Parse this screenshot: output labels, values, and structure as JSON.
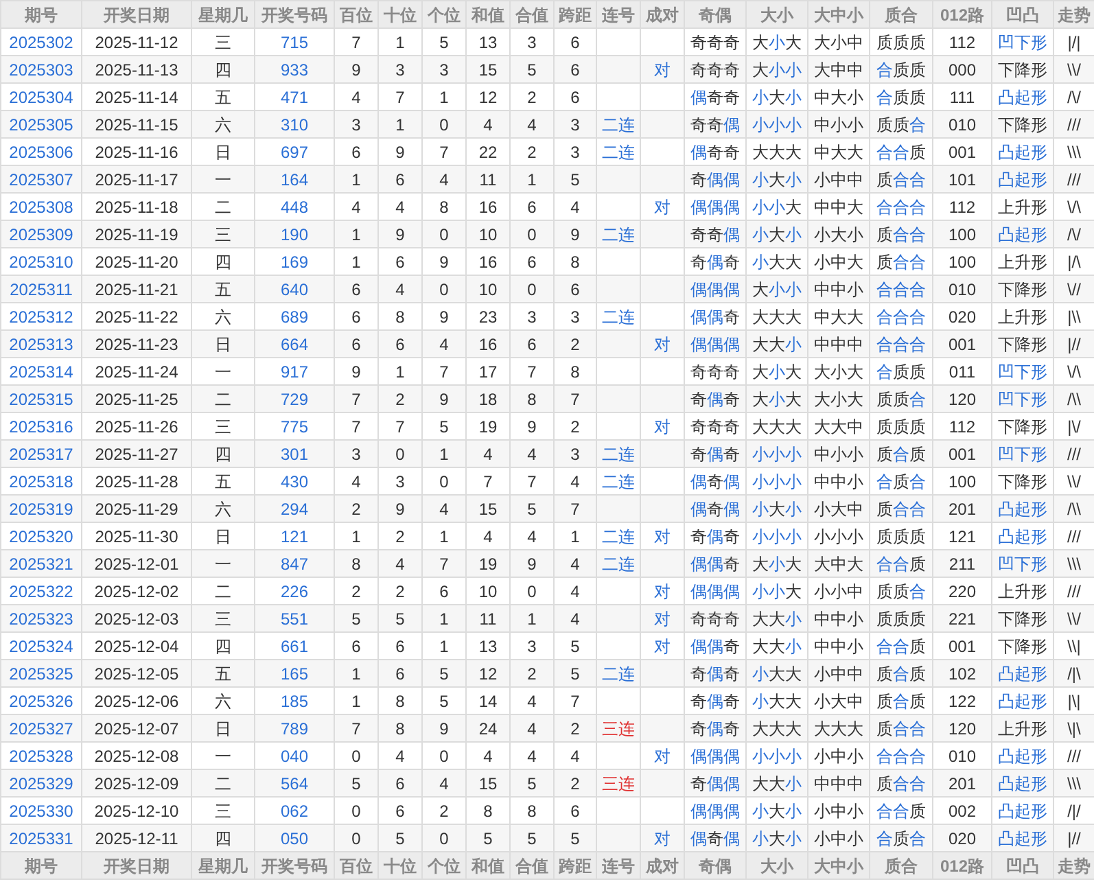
{
  "header": [
    "期号",
    "开奖日期",
    "星期几",
    "开奖号码",
    "百位",
    "十位",
    "个位",
    "和值",
    "合值",
    "跨距",
    "连号",
    "成对",
    "奇偶",
    "大小",
    "大中小",
    "质合",
    "012路",
    "凹凸",
    "走势"
  ],
  "rows": [
    {
      "issue": "2025302",
      "date": "2025-11-12",
      "weekday": "三",
      "number": "715",
      "hundreds": "7",
      "tens": "1",
      "ones": "5",
      "sum": "13",
      "sum_tail": "3",
      "span": "6",
      "parity": {
        "text": "奇奇奇",
        "hl": [
          false,
          false,
          false
        ]
      },
      "size": {
        "text": "大小大",
        "hl": [
          false,
          true,
          false
        ]
      },
      "bms": "大小中",
      "prime": {
        "text": "质质质",
        "hl": [
          false,
          false,
          false
        ]
      },
      "route012": "112",
      "shape": {
        "text": "凹下形",
        "hl": true
      },
      "trend": "|/|"
    },
    {
      "issue": "2025303",
      "date": "2025-11-13",
      "weekday": "四",
      "number": "933",
      "hundreds": "9",
      "tens": "3",
      "ones": "3",
      "sum": "15",
      "sum_tail": "5",
      "span": "6",
      "pair": "对",
      "parity": {
        "text": "奇奇奇",
        "hl": [
          false,
          false,
          false
        ]
      },
      "size": {
        "text": "大小小",
        "hl": [
          false,
          true,
          true
        ]
      },
      "bms": "大中中",
      "prime": {
        "text": "合质质",
        "hl": [
          true,
          false,
          false
        ]
      },
      "route012": "000",
      "shape": {
        "text": "下降形",
        "hl": false
      },
      "trend": "\\\\/"
    },
    {
      "issue": "2025304",
      "date": "2025-11-14",
      "weekday": "五",
      "number": "471",
      "hundreds": "4",
      "tens": "7",
      "ones": "1",
      "sum": "12",
      "sum_tail": "2",
      "span": "6",
      "parity": {
        "text": "偶奇奇",
        "hl": [
          true,
          false,
          false
        ]
      },
      "size": {
        "text": "小大小",
        "hl": [
          true,
          false,
          true
        ]
      },
      "bms": "中大小",
      "prime": {
        "text": "合质质",
        "hl": [
          true,
          false,
          false
        ]
      },
      "route012": "111",
      "shape": {
        "text": "凸起形",
        "hl": true
      },
      "trend": "/\\/"
    },
    {
      "issue": "2025305",
      "date": "2025-11-15",
      "weekday": "六",
      "number": "310",
      "hundreds": "3",
      "tens": "1",
      "ones": "0",
      "sum": "4",
      "sum_tail": "4",
      "span": "3",
      "consec": {
        "text": "二连",
        "color": "#2a6fd6"
      },
      "parity": {
        "text": "奇奇偶",
        "hl": [
          false,
          false,
          true
        ]
      },
      "size": {
        "text": "小小小",
        "hl": [
          true,
          true,
          true
        ]
      },
      "bms": "中小小",
      "prime": {
        "text": "质质合",
        "hl": [
          false,
          false,
          true
        ]
      },
      "route012": "010",
      "shape": {
        "text": "下降形",
        "hl": false
      },
      "trend": "///"
    },
    {
      "issue": "2025306",
      "date": "2025-11-16",
      "weekday": "日",
      "number": "697",
      "hundreds": "6",
      "tens": "9",
      "ones": "7",
      "sum": "22",
      "sum_tail": "2",
      "span": "3",
      "consec": {
        "text": "二连",
        "color": "#2a6fd6"
      },
      "parity": {
        "text": "偶奇奇",
        "hl": [
          true,
          false,
          false
        ]
      },
      "size": {
        "text": "大大大",
        "hl": [
          false,
          false,
          false
        ]
      },
      "bms": "中大大",
      "prime": {
        "text": "合合质",
        "hl": [
          true,
          true,
          false
        ]
      },
      "route012": "001",
      "shape": {
        "text": "凸起形",
        "hl": true
      },
      "trend": "\\\\\\"
    },
    {
      "issue": "2025307",
      "date": "2025-11-17",
      "weekday": "一",
      "number": "164",
      "hundreds": "1",
      "tens": "6",
      "ones": "4",
      "sum": "11",
      "sum_tail": "1",
      "span": "5",
      "parity": {
        "text": "奇偶偶",
        "hl": [
          false,
          true,
          true
        ]
      },
      "size": {
        "text": "小大小",
        "hl": [
          true,
          false,
          true
        ]
      },
      "bms": "小中中",
      "prime": {
        "text": "质合合",
        "hl": [
          false,
          true,
          true
        ]
      },
      "route012": "101",
      "shape": {
        "text": "凸起形",
        "hl": true
      },
      "trend": "///"
    },
    {
      "issue": "2025308",
      "date": "2025-11-18",
      "weekday": "二",
      "number": "448",
      "hundreds": "4",
      "tens": "4",
      "ones": "8",
      "sum": "16",
      "sum_tail": "6",
      "span": "4",
      "pair": "对",
      "parity": {
        "text": "偶偶偶",
        "hl": [
          true,
          true,
          true
        ]
      },
      "size": {
        "text": "小小大",
        "hl": [
          true,
          true,
          false
        ]
      },
      "bms": "中中大",
      "prime": {
        "text": "合合合",
        "hl": [
          true,
          true,
          true
        ]
      },
      "route012": "112",
      "shape": {
        "text": "上升形",
        "hl": false
      },
      "trend": "\\/\\"
    },
    {
      "issue": "2025309",
      "date": "2025-11-19",
      "weekday": "三",
      "number": "190",
      "hundreds": "1",
      "tens": "9",
      "ones": "0",
      "sum": "10",
      "sum_tail": "0",
      "span": "9",
      "consec": {
        "text": "二连",
        "color": "#2a6fd6"
      },
      "parity": {
        "text": "奇奇偶",
        "hl": [
          false,
          false,
          true
        ]
      },
      "size": {
        "text": "小大小",
        "hl": [
          true,
          false,
          true
        ]
      },
      "bms": "小大小",
      "prime": {
        "text": "质合合",
        "hl": [
          false,
          true,
          true
        ]
      },
      "route012": "100",
      "shape": {
        "text": "凸起形",
        "hl": true
      },
      "trend": "/\\/"
    },
    {
      "issue": "2025310",
      "date": "2025-11-20",
      "weekday": "四",
      "number": "169",
      "hundreds": "1",
      "tens": "6",
      "ones": "9",
      "sum": "16",
      "sum_tail": "6",
      "span": "8",
      "parity": {
        "text": "奇偶奇",
        "hl": [
          false,
          true,
          false
        ]
      },
      "size": {
        "text": "小大大",
        "hl": [
          true,
          false,
          false
        ]
      },
      "bms": "小中大",
      "prime": {
        "text": "质合合",
        "hl": [
          false,
          true,
          true
        ]
      },
      "route012": "100",
      "shape": {
        "text": "上升形",
        "hl": false
      },
      "trend": "|/\\"
    },
    {
      "issue": "2025311",
      "date": "2025-11-21",
      "weekday": "五",
      "number": "640",
      "hundreds": "6",
      "tens": "4",
      "ones": "0",
      "sum": "10",
      "sum_tail": "0",
      "span": "6",
      "parity": {
        "text": "偶偶偶",
        "hl": [
          true,
          true,
          true
        ]
      },
      "size": {
        "text": "大小小",
        "hl": [
          false,
          true,
          true
        ]
      },
      "bms": "中中小",
      "prime": {
        "text": "合合合",
        "hl": [
          true,
          true,
          true
        ]
      },
      "route012": "010",
      "shape": {
        "text": "下降形",
        "hl": false
      },
      "trend": "\\//"
    },
    {
      "issue": "2025312",
      "date": "2025-11-22",
      "weekday": "六",
      "number": "689",
      "hundreds": "6",
      "tens": "8",
      "ones": "9",
      "sum": "23",
      "sum_tail": "3",
      "span": "3",
      "consec": {
        "text": "二连",
        "color": "#2a6fd6"
      },
      "parity": {
        "text": "偶偶奇",
        "hl": [
          true,
          true,
          false
        ]
      },
      "size": {
        "text": "大大大",
        "hl": [
          false,
          false,
          false
        ]
      },
      "bms": "中大大",
      "prime": {
        "text": "合合合",
        "hl": [
          true,
          true,
          true
        ]
      },
      "route012": "020",
      "shape": {
        "text": "上升形",
        "hl": false
      },
      "trend": "|\\\\"
    },
    {
      "issue": "2025313",
      "date": "2025-11-23",
      "weekday": "日",
      "number": "664",
      "hundreds": "6",
      "tens": "6",
      "ones": "4",
      "sum": "16",
      "sum_tail": "6",
      "span": "2",
      "pair": "对",
      "parity": {
        "text": "偶偶偶",
        "hl": [
          true,
          true,
          true
        ]
      },
      "size": {
        "text": "大大小",
        "hl": [
          false,
          false,
          true
        ]
      },
      "bms": "中中中",
      "prime": {
        "text": "合合合",
        "hl": [
          true,
          true,
          true
        ]
      },
      "route012": "001",
      "shape": {
        "text": "下降形",
        "hl": false
      },
      "trend": "|//"
    },
    {
      "issue": "2025314",
      "date": "2025-11-24",
      "weekday": "一",
      "number": "917",
      "hundreds": "9",
      "tens": "1",
      "ones": "7",
      "sum": "17",
      "sum_tail": "7",
      "span": "8",
      "parity": {
        "text": "奇奇奇",
        "hl": [
          false,
          false,
          false
        ]
      },
      "size": {
        "text": "大小大",
        "hl": [
          false,
          true,
          false
        ]
      },
      "bms": "大小大",
      "prime": {
        "text": "合质质",
        "hl": [
          true,
          false,
          false
        ]
      },
      "route012": "011",
      "shape": {
        "text": "凹下形",
        "hl": true
      },
      "trend": "\\/\\"
    },
    {
      "issue": "2025315",
      "date": "2025-11-25",
      "weekday": "二",
      "number": "729",
      "hundreds": "7",
      "tens": "2",
      "ones": "9",
      "sum": "18",
      "sum_tail": "8",
      "span": "7",
      "parity": {
        "text": "奇偶奇",
        "hl": [
          false,
          true,
          false
        ]
      },
      "size": {
        "text": "大小大",
        "hl": [
          false,
          true,
          false
        ]
      },
      "bms": "大小大",
      "prime": {
        "text": "质质合",
        "hl": [
          false,
          false,
          true
        ]
      },
      "route012": "120",
      "shape": {
        "text": "凹下形",
        "hl": true
      },
      "trend": "/\\\\"
    },
    {
      "issue": "2025316",
      "date": "2025-11-26",
      "weekday": "三",
      "number": "775",
      "hundreds": "7",
      "tens": "7",
      "ones": "5",
      "sum": "19",
      "sum_tail": "9",
      "span": "2",
      "pair": "对",
      "parity": {
        "text": "奇奇奇",
        "hl": [
          false,
          false,
          false
        ]
      },
      "size": {
        "text": "大大大",
        "hl": [
          false,
          false,
          false
        ]
      },
      "bms": "大大中",
      "prime": {
        "text": "质质质",
        "hl": [
          false,
          false,
          false
        ]
      },
      "route012": "112",
      "shape": {
        "text": "下降形",
        "hl": false
      },
      "trend": "|\\/"
    },
    {
      "issue": "2025317",
      "date": "2025-11-27",
      "weekday": "四",
      "number": "301",
      "hundreds": "3",
      "tens": "0",
      "ones": "1",
      "sum": "4",
      "sum_tail": "4",
      "span": "3",
      "consec": {
        "text": "二连",
        "color": "#2a6fd6"
      },
      "parity": {
        "text": "奇偶奇",
        "hl": [
          false,
          true,
          false
        ]
      },
      "size": {
        "text": "小小小",
        "hl": [
          true,
          true,
          true
        ]
      },
      "bms": "中小小",
      "prime": {
        "text": "质合质",
        "hl": [
          false,
          true,
          false
        ]
      },
      "route012": "001",
      "shape": {
        "text": "凹下形",
        "hl": true
      },
      "trend": "///"
    },
    {
      "issue": "2025318",
      "date": "2025-11-28",
      "weekday": "五",
      "number": "430",
      "hundreds": "4",
      "tens": "3",
      "ones": "0",
      "sum": "7",
      "sum_tail": "7",
      "span": "4",
      "consec": {
        "text": "二连",
        "color": "#2a6fd6"
      },
      "parity": {
        "text": "偶奇偶",
        "hl": [
          true,
          false,
          true
        ]
      },
      "size": {
        "text": "小小小",
        "hl": [
          true,
          true,
          true
        ]
      },
      "bms": "中中小",
      "prime": {
        "text": "合质合",
        "hl": [
          true,
          false,
          true
        ]
      },
      "route012": "100",
      "shape": {
        "text": "下降形",
        "hl": false
      },
      "trend": "\\\\/"
    },
    {
      "issue": "2025319",
      "date": "2025-11-29",
      "weekday": "六",
      "number": "294",
      "hundreds": "2",
      "tens": "9",
      "ones": "4",
      "sum": "15",
      "sum_tail": "5",
      "span": "7",
      "parity": {
        "text": "偶奇偶",
        "hl": [
          true,
          false,
          true
        ]
      },
      "size": {
        "text": "小大小",
        "hl": [
          true,
          false,
          true
        ]
      },
      "bms": "小大中",
      "prime": {
        "text": "质合合",
        "hl": [
          false,
          true,
          true
        ]
      },
      "route012": "201",
      "shape": {
        "text": "凸起形",
        "hl": true
      },
      "trend": "/\\\\"
    },
    {
      "issue": "2025320",
      "date": "2025-11-30",
      "weekday": "日",
      "number": "121",
      "hundreds": "1",
      "tens": "2",
      "ones": "1",
      "sum": "4",
      "sum_tail": "4",
      "span": "1",
      "consec": {
        "text": "二连",
        "color": "#2a6fd6"
      },
      "pair": "对",
      "parity": {
        "text": "奇偶奇",
        "hl": [
          false,
          true,
          false
        ]
      },
      "size": {
        "text": "小小小",
        "hl": [
          true,
          true,
          true
        ]
      },
      "bms": "小小小",
      "prime": {
        "text": "质质质",
        "hl": [
          false,
          false,
          false
        ]
      },
      "route012": "121",
      "shape": {
        "text": "凸起形",
        "hl": true
      },
      "trend": "///"
    },
    {
      "issue": "2025321",
      "date": "2025-12-01",
      "weekday": "一",
      "number": "847",
      "hundreds": "8",
      "tens": "4",
      "ones": "7",
      "sum": "19",
      "sum_tail": "9",
      "span": "4",
      "consec": {
        "text": "二连",
        "color": "#2a6fd6"
      },
      "parity": {
        "text": "偶偶奇",
        "hl": [
          true,
          true,
          false
        ]
      },
      "size": {
        "text": "大小大",
        "hl": [
          false,
          true,
          false
        ]
      },
      "bms": "大中大",
      "prime": {
        "text": "合合质",
        "hl": [
          true,
          true,
          false
        ]
      },
      "route012": "211",
      "shape": {
        "text": "凹下形",
        "hl": true
      },
      "trend": "\\\\\\"
    },
    {
      "issue": "2025322",
      "date": "2025-12-02",
      "weekday": "二",
      "number": "226",
      "hundreds": "2",
      "tens": "2",
      "ones": "6",
      "sum": "10",
      "sum_tail": "0",
      "span": "4",
      "pair": "对",
      "parity": {
        "text": "偶偶偶",
        "hl": [
          true,
          true,
          true
        ]
      },
      "size": {
        "text": "小小大",
        "hl": [
          true,
          true,
          false
        ]
      },
      "bms": "小小中",
      "prime": {
        "text": "质质合",
        "hl": [
          false,
          false,
          true
        ]
      },
      "route012": "220",
      "shape": {
        "text": "上升形",
        "hl": false
      },
      "trend": "///"
    },
    {
      "issue": "2025323",
      "date": "2025-12-03",
      "weekday": "三",
      "number": "551",
      "hundreds": "5",
      "tens": "5",
      "ones": "1",
      "sum": "11",
      "sum_tail": "1",
      "span": "4",
      "pair": "对",
      "parity": {
        "text": "奇奇奇",
        "hl": [
          false,
          false,
          false
        ]
      },
      "size": {
        "text": "大大小",
        "hl": [
          false,
          false,
          true
        ]
      },
      "bms": "中中小",
      "prime": {
        "text": "质质质",
        "hl": [
          false,
          false,
          false
        ]
      },
      "route012": "221",
      "shape": {
        "text": "下降形",
        "hl": false
      },
      "trend": "\\\\/"
    },
    {
      "issue": "2025324",
      "date": "2025-12-04",
      "weekday": "四",
      "number": "661",
      "hundreds": "6",
      "tens": "6",
      "ones": "1",
      "sum": "13",
      "sum_tail": "3",
      "span": "5",
      "pair": "对",
      "parity": {
        "text": "偶偶奇",
        "hl": [
          true,
          true,
          false
        ]
      },
      "size": {
        "text": "大大小",
        "hl": [
          false,
          false,
          true
        ]
      },
      "bms": "中中小",
      "prime": {
        "text": "合合质",
        "hl": [
          true,
          true,
          false
        ]
      },
      "route012": "001",
      "shape": {
        "text": "下降形",
        "hl": false
      },
      "trend": "\\\\|"
    },
    {
      "issue": "2025325",
      "date": "2025-12-05",
      "weekday": "五",
      "number": "165",
      "hundreds": "1",
      "tens": "6",
      "ones": "5",
      "sum": "12",
      "sum_tail": "2",
      "span": "5",
      "consec": {
        "text": "二连",
        "color": "#2a6fd6"
      },
      "parity": {
        "text": "奇偶奇",
        "hl": [
          false,
          true,
          false
        ]
      },
      "size": {
        "text": "小大大",
        "hl": [
          true,
          false,
          false
        ]
      },
      "bms": "小中中",
      "prime": {
        "text": "质合质",
        "hl": [
          false,
          true,
          false
        ]
      },
      "route012": "102",
      "shape": {
        "text": "凸起形",
        "hl": true
      },
      "trend": "/|\\"
    },
    {
      "issue": "2025326",
      "date": "2025-12-06",
      "weekday": "六",
      "number": "185",
      "hundreds": "1",
      "tens": "8",
      "ones": "5",
      "sum": "14",
      "sum_tail": "4",
      "span": "7",
      "parity": {
        "text": "奇偶奇",
        "hl": [
          false,
          true,
          false
        ]
      },
      "size": {
        "text": "小大大",
        "hl": [
          true,
          false,
          false
        ]
      },
      "bms": "小大中",
      "prime": {
        "text": "质合质",
        "hl": [
          false,
          true,
          false
        ]
      },
      "route012": "122",
      "shape": {
        "text": "凸起形",
        "hl": true
      },
      "trend": "|\\|"
    },
    {
      "issue": "2025327",
      "date": "2025-12-07",
      "weekday": "日",
      "number": "789",
      "hundreds": "7",
      "tens": "8",
      "ones": "9",
      "sum": "24",
      "sum_tail": "4",
      "span": "2",
      "consec": {
        "text": "三连",
        "color": "#e03131"
      },
      "parity": {
        "text": "奇偶奇",
        "hl": [
          false,
          true,
          false
        ]
      },
      "size": {
        "text": "大大大",
        "hl": [
          false,
          false,
          false
        ]
      },
      "bms": "大大大",
      "prime": {
        "text": "质合合",
        "hl": [
          false,
          true,
          true
        ]
      },
      "route012": "120",
      "shape": {
        "text": "上升形",
        "hl": false
      },
      "trend": "\\|\\"
    },
    {
      "issue": "2025328",
      "date": "2025-12-08",
      "weekday": "一",
      "number": "040",
      "hundreds": "0",
      "tens": "4",
      "ones": "0",
      "sum": "4",
      "sum_tail": "4",
      "span": "4",
      "pair": "对",
      "parity": {
        "text": "偶偶偶",
        "hl": [
          true,
          true,
          true
        ]
      },
      "size": {
        "text": "小小小",
        "hl": [
          true,
          true,
          true
        ]
      },
      "bms": "小中小",
      "prime": {
        "text": "合合合",
        "hl": [
          true,
          true,
          true
        ]
      },
      "route012": "010",
      "shape": {
        "text": "凸起形",
        "hl": true
      },
      "trend": "///"
    },
    {
      "issue": "2025329",
      "date": "2025-12-09",
      "weekday": "二",
      "number": "564",
      "hundreds": "5",
      "tens": "6",
      "ones": "4",
      "sum": "15",
      "sum_tail": "5",
      "span": "2",
      "consec": {
        "text": "三连",
        "color": "#e03131"
      },
      "parity": {
        "text": "奇偶偶",
        "hl": [
          false,
          true,
          true
        ]
      },
      "size": {
        "text": "大大小",
        "hl": [
          false,
          false,
          true
        ]
      },
      "bms": "中中中",
      "prime": {
        "text": "质合合",
        "hl": [
          false,
          true,
          true
        ]
      },
      "route012": "201",
      "shape": {
        "text": "凸起形",
        "hl": true
      },
      "trend": "\\\\\\"
    },
    {
      "issue": "2025330",
      "date": "2025-12-10",
      "weekday": "三",
      "number": "062",
      "hundreds": "0",
      "tens": "6",
      "ones": "2",
      "sum": "8",
      "sum_tail": "8",
      "span": "6",
      "parity": {
        "text": "偶偶偶",
        "hl": [
          true,
          true,
          true
        ]
      },
      "size": {
        "text": "小大小",
        "hl": [
          true,
          false,
          true
        ]
      },
      "bms": "小中小",
      "prime": {
        "text": "合合质",
        "hl": [
          true,
          true,
          false
        ]
      },
      "route012": "002",
      "shape": {
        "text": "凸起形",
        "hl": true
      },
      "trend": "/|/"
    },
    {
      "issue": "2025331",
      "date": "2025-12-11",
      "weekday": "四",
      "number": "050",
      "hundreds": "0",
      "tens": "5",
      "ones": "0",
      "sum": "5",
      "sum_tail": "5",
      "span": "5",
      "pair": "对",
      "parity": {
        "text": "偶奇偶",
        "hl": [
          true,
          false,
          true
        ]
      },
      "size": {
        "text": "小大小",
        "hl": [
          true,
          false,
          true
        ]
      },
      "bms": "小中小",
      "prime": {
        "text": "合质合",
        "hl": [
          true,
          false,
          true
        ]
      },
      "route012": "020",
      "shape": {
        "text": "凸起形",
        "hl": true
      },
      "trend": "|//"
    }
  ],
  "footer": [
    "期号",
    "开奖日期",
    "星期几",
    "开奖号码",
    "百位",
    "十位",
    "个位",
    "和值",
    "合值",
    "跨距",
    "连号",
    "成对",
    "奇偶",
    "大小",
    "大中小",
    "质合",
    "012路",
    "凹凸",
    "走势"
  ]
}
